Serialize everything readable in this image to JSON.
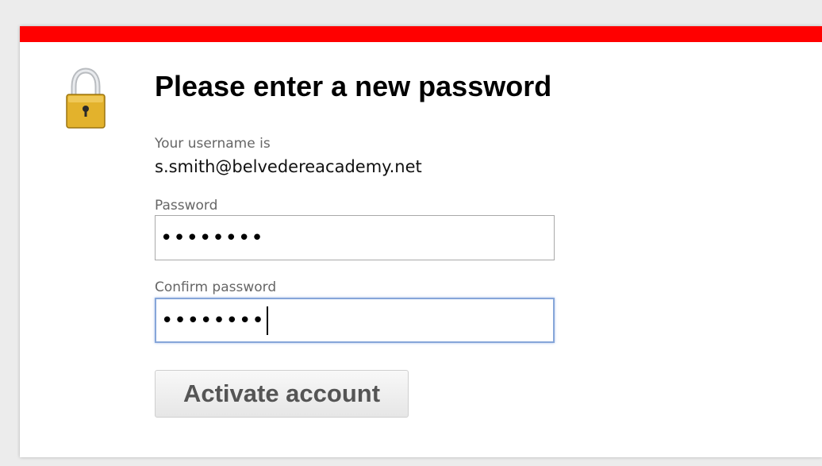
{
  "colors": {
    "accent_bar": "#ff0000",
    "lock_body": "#e3b22c"
  },
  "header": {
    "title": "Please enter a new password",
    "icon": "padlock-icon"
  },
  "account": {
    "username_label": "Your username is",
    "username": "s.smith@belvedereacademy.net"
  },
  "form": {
    "password_label": "Password",
    "password_value": "••••••••",
    "confirm_label": "Confirm password",
    "confirm_value": "••••••••",
    "submit_label": "Activate account"
  }
}
